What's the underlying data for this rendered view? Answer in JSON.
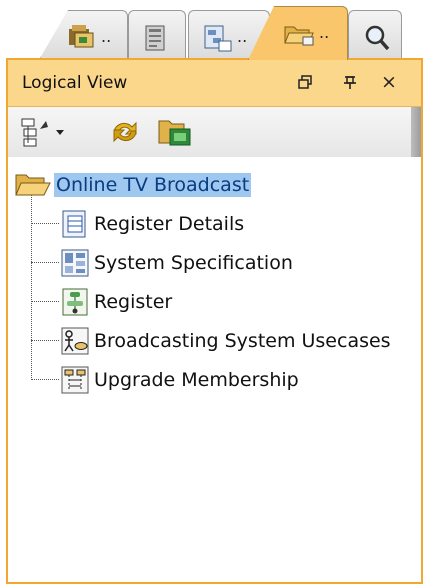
{
  "tabs": [
    {
      "id": "model",
      "icon": "model-explorer-icon",
      "label": "..",
      "active": false
    },
    {
      "id": "document",
      "icon": "document-icon",
      "label": "",
      "active": false
    },
    {
      "id": "diagram",
      "icon": "diagram-navigator-icon",
      "label": "..",
      "active": false
    },
    {
      "id": "logical",
      "icon": "logical-view-icon",
      "label": "..",
      "active": true
    },
    {
      "id": "search",
      "icon": "search-icon",
      "label": "",
      "active": false
    }
  ],
  "panel": {
    "title": "Logical View",
    "controls": [
      "restore-icon",
      "pin-icon",
      "close-icon"
    ],
    "close_glyph": "×"
  },
  "toolbar": {
    "items": [
      "tree-view-icon",
      "dropdown-arrow-icon",
      "refresh-icon",
      "new-folder-icon"
    ]
  },
  "tree": {
    "root": {
      "label": "Online TV Broadcast",
      "icon": "folder-icon"
    },
    "children": [
      {
        "label": "Register Details",
        "icon": "class-diagram-icon"
      },
      {
        "label": "System Specification",
        "icon": "requirement-diagram-icon"
      },
      {
        "label": "Register",
        "icon": "activity-diagram-icon"
      },
      {
        "label": "Broadcasting System Usecases",
        "icon": "usecase-diagram-icon"
      },
      {
        "label": "Upgrade Membership",
        "icon": "sequence-diagram-icon"
      }
    ]
  },
  "colors": {
    "accent": "#f0a830",
    "titlebar": "#fbd78b",
    "selection": "#9ec8ef"
  }
}
